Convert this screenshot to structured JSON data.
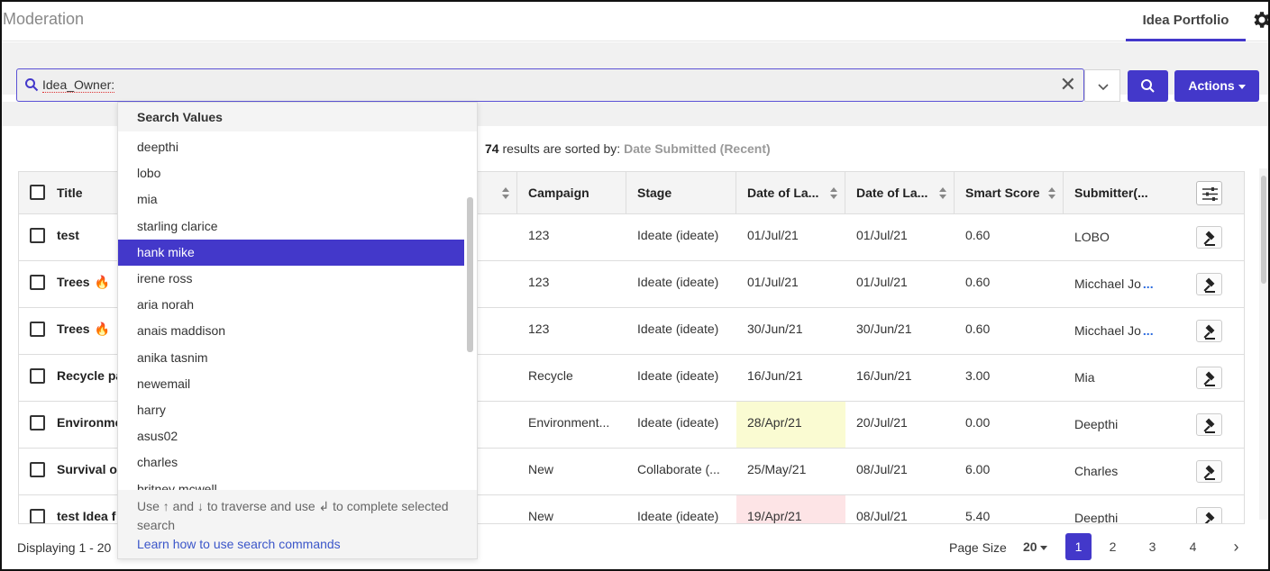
{
  "header": {
    "app_title": "Moderation",
    "tab_label": "Idea Portfolio"
  },
  "search": {
    "query": "Idea_Owner:",
    "clear_glyph": "✕",
    "actions_label": "Actions"
  },
  "results": {
    "count": "74",
    "sorted_text": "results are sorted by:",
    "sort_value": "Date Submitted (Recent)"
  },
  "table": {
    "columns": [
      "Title",
      "Campaign",
      "Stage",
      "Date of La...",
      "Date of La...",
      "Smart Score",
      "Submitter(..."
    ],
    "rows": [
      {
        "title": "test",
        "fire": "",
        "campaign": "123",
        "stage": "Ideate (ideate)",
        "date1": "01/Jul/21",
        "date2": "01/Jul/21",
        "score": "0.60",
        "submitter": "LOBO",
        "more": ""
      },
      {
        "title": "Trees",
        "fire": "🔥",
        "campaign": "123",
        "stage": "Ideate (ideate)",
        "date1": "01/Jul/21",
        "date2": "01/Jul/21",
        "score": "0.60",
        "submitter": "Micchael Jo",
        "more": "..."
      },
      {
        "title": "Trees",
        "fire": "🔥",
        "campaign": "123",
        "stage": "Ideate (ideate)",
        "date1": "30/Jun/21",
        "date2": "30/Jun/21",
        "score": "0.60",
        "submitter": "Micchael Jo",
        "more": "..."
      },
      {
        "title": "Recycle pa",
        "fire": "",
        "campaign": "Recycle",
        "stage": "Ideate (ideate)",
        "date1": "16/Jun/21",
        "date2": "16/Jun/21",
        "score": "3.00",
        "submitter": "Mia",
        "more": ""
      },
      {
        "title": "Environme",
        "fire": "",
        "campaign": "Environment...",
        "stage": "Ideate (ideate)",
        "date1": "28/Apr/21",
        "date2": "20/Jul/21",
        "score": "0.00",
        "submitter": "Deepthi",
        "more": ""
      },
      {
        "title": "Survival o",
        "fire": "",
        "campaign": "New",
        "stage": "Collaborate (...",
        "date1": "25/May/21",
        "date2": "08/Jul/21",
        "score": "6.00",
        "submitter": "Charles",
        "more": ""
      },
      {
        "title": "test Idea f",
        "fire": "",
        "campaign": "New",
        "stage": "Ideate (ideate)",
        "date1": "19/Apr/21",
        "date2": "08/Jul/21",
        "score": "5.40",
        "submitter": "Deepthi",
        "more": ""
      }
    ]
  },
  "dropdown": {
    "header": "Search Values",
    "items": [
      "deepthi",
      "lobo",
      "mia",
      "starling clarice",
      "hank mike",
      "irene ross",
      "aria norah",
      "anais maddison",
      "anika tasnim",
      "newemail",
      "harry",
      "asus02",
      "charles",
      "britney mcwell"
    ],
    "selected_index": 4,
    "help_text": "Use ↑ and ↓ to traverse and use ↲ to complete selected search",
    "help_link": "Learn how to use search commands"
  },
  "footer": {
    "displaying": "Displaying 1 - 20",
    "page_size_label": "Page Size",
    "page_size_value": "20",
    "pages": [
      "1",
      "2",
      "3",
      "4"
    ],
    "current_page": "1",
    "next_glyph": "›"
  },
  "colors": {
    "accent": "#4338ca",
    "highlight_yellow": "#fafbd2",
    "highlight_pink": "#fde4e6"
  }
}
